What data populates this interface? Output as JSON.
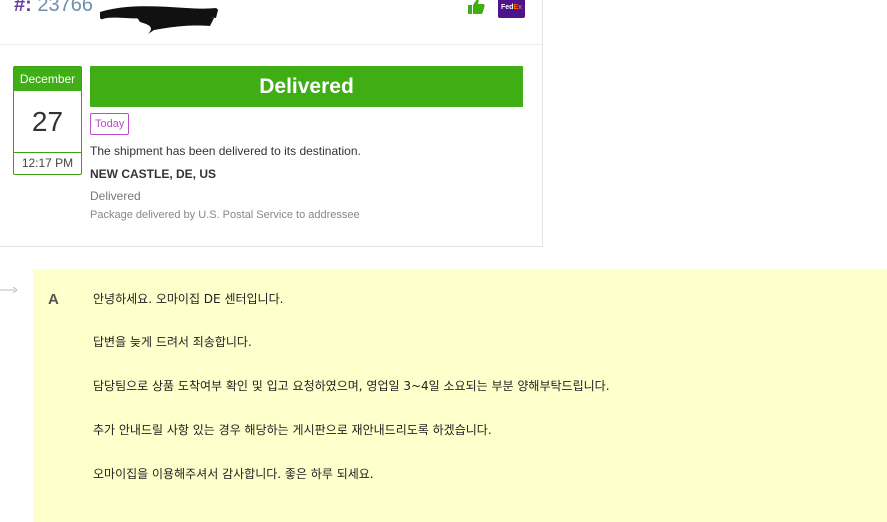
{
  "header": {
    "hash": "#:",
    "tracking_visible": "23766",
    "carrier_logo": {
      "text_fed": "Fed",
      "text_ex": "Ex",
      "color": "#4d148c"
    },
    "thumb_icon": "thumbs-up-icon"
  },
  "event": {
    "month": "December",
    "day": "27",
    "time": "12:17 PM",
    "status": "Delivered",
    "badge": "Today",
    "message": "The shipment has been delivered to its destination.",
    "location": "NEW CASTLE, DE, US",
    "status_detail": "Delivered",
    "note": "Package delivered by U.S. Postal Service to addressee",
    "accent_color": "#3eae14",
    "badge_color": "#b84fc9"
  },
  "answer": {
    "label": "A",
    "lines": [
      "안녕하세요. 오마이집 DE 센터입니다.",
      "답변을 늦게 드려서 죄송합니다.",
      "담당팀으로 상품 도착여부 확인 및 입고 요청하였으며, 영업일 3~4일 소요되는 부분 양해부탁드립니다.",
      "추가 안내드릴 사항 있는 경우 해당하는 게시판으로 재안내드리도록 하겠습니다.",
      "오마이집을 이용해주셔서 감사합니다. 좋은 하루 되세요."
    ],
    "background": "#ffffcc"
  }
}
